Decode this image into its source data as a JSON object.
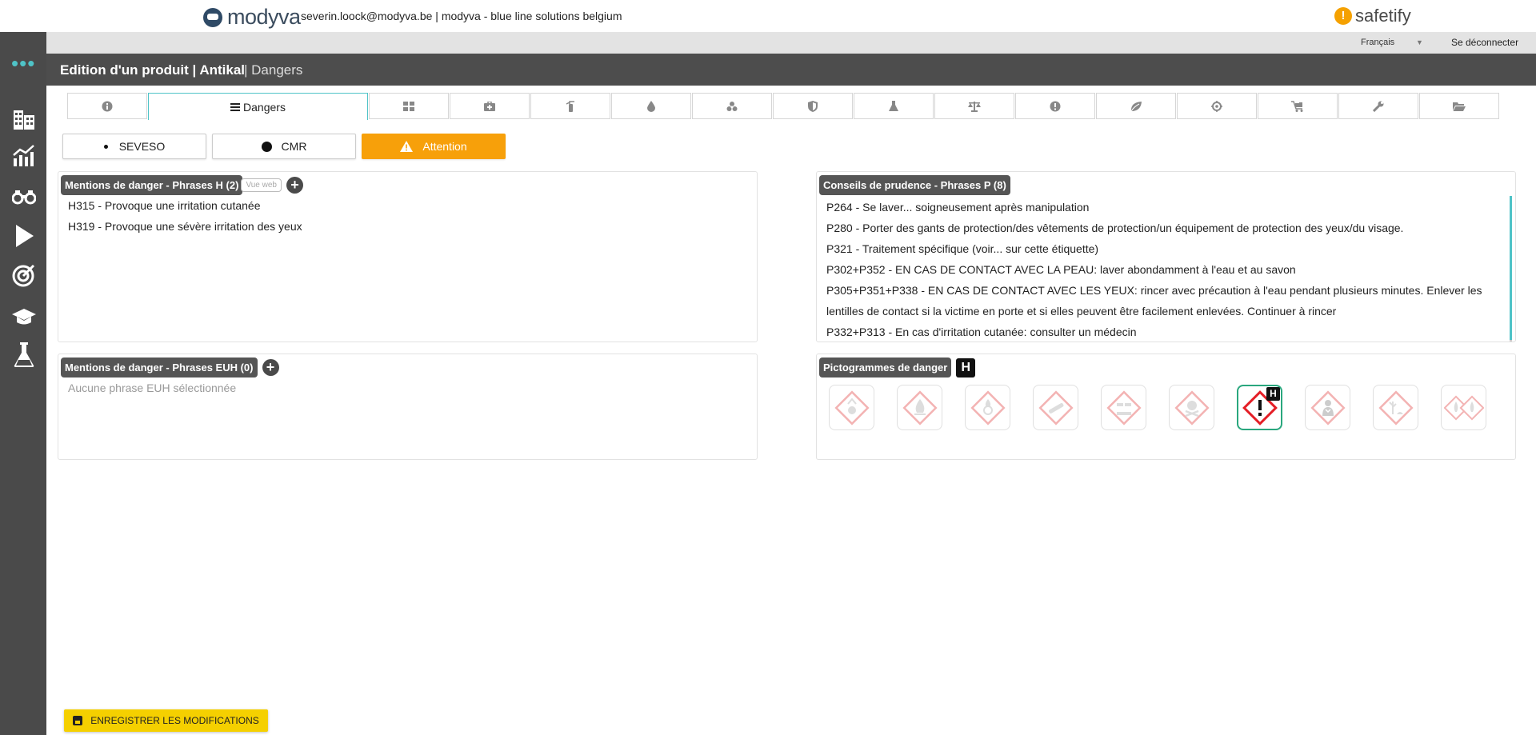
{
  "header": {
    "brand": "modyva",
    "user_line": "severin.loock@modyva.be | modyva - blue line solutions belgium",
    "safetify": "safetify"
  },
  "langbar": {
    "language": "Français",
    "logout": "Se déconnecter"
  },
  "titlebar": {
    "title": "Edition d'un produit | Antikal",
    "subtitle": "| Dangers"
  },
  "tabs": {
    "active_label": "Dangers",
    "icons": [
      "info-icon",
      "list-icon",
      "grid-icon",
      "first-aid-icon",
      "extinguisher-icon",
      "drop-icon",
      "biohazard-icon",
      "shield-icon",
      "flask-icon",
      "scale-icon",
      "alert-icon",
      "leaf-icon",
      "target-icon",
      "cart-icon",
      "wrench-icon",
      "folder-icon"
    ]
  },
  "classification": {
    "seveso": "SEVESO",
    "cmr": "CMR",
    "signal": "Attention",
    "signal_color": "#f7a00a"
  },
  "h_phrases": {
    "label": "Mentions de danger - Phrases H (2)",
    "web_view": "Vue web",
    "items": [
      "H315 - Provoque une irritation cutanée",
      "H319 - Provoque une sévère irritation des yeux"
    ]
  },
  "euh_phrases": {
    "label": "Mentions de danger - Phrases EUH (0)",
    "empty": "Aucune phrase EUH sélectionnée"
  },
  "p_phrases": {
    "label": "Conseils de prudence - Phrases P (8)",
    "items": [
      "P264 - Se laver... soigneusement après manipulation",
      "P280 - Porter des gants de protection/des vêtements de protection/un équipement de protection des yeux/du visage.",
      "P321 - Traitement spécifique (voir... sur cette étiquette)",
      "P302+P352 - EN CAS DE CONTACT AVEC LA PEAU: laver abondamment à  l'eau et au savon",
      "P305+P351+P338 - EN CAS DE CONTACT AVEC LES YEUX: rincer avec précaution à  l'eau pendant plusieurs minutes. Enlever les lentilles de contact si la victime en porte et si elles peuvent être facilement enlevées. Continuer à  rincer",
      "P332+P313 - En cas d'irritation cutanée: consulter un médecin"
    ]
  },
  "pictograms": {
    "label": "Pictogrammes de danger",
    "h_badge": "H",
    "items": [
      {
        "name": "explosive",
        "selected": false
      },
      {
        "name": "flammable",
        "selected": false
      },
      {
        "name": "oxidizing",
        "selected": false
      },
      {
        "name": "gas-cylinder",
        "selected": false
      },
      {
        "name": "corrosive",
        "selected": false
      },
      {
        "name": "toxic",
        "selected": false
      },
      {
        "name": "exclamation",
        "selected": true
      },
      {
        "name": "health-hazard",
        "selected": false
      },
      {
        "name": "environment",
        "selected": false
      },
      {
        "name": "flame-pair",
        "selected": false
      }
    ]
  },
  "footer": {
    "save": "ENREGISTRER LES MODIFICATIONS"
  }
}
